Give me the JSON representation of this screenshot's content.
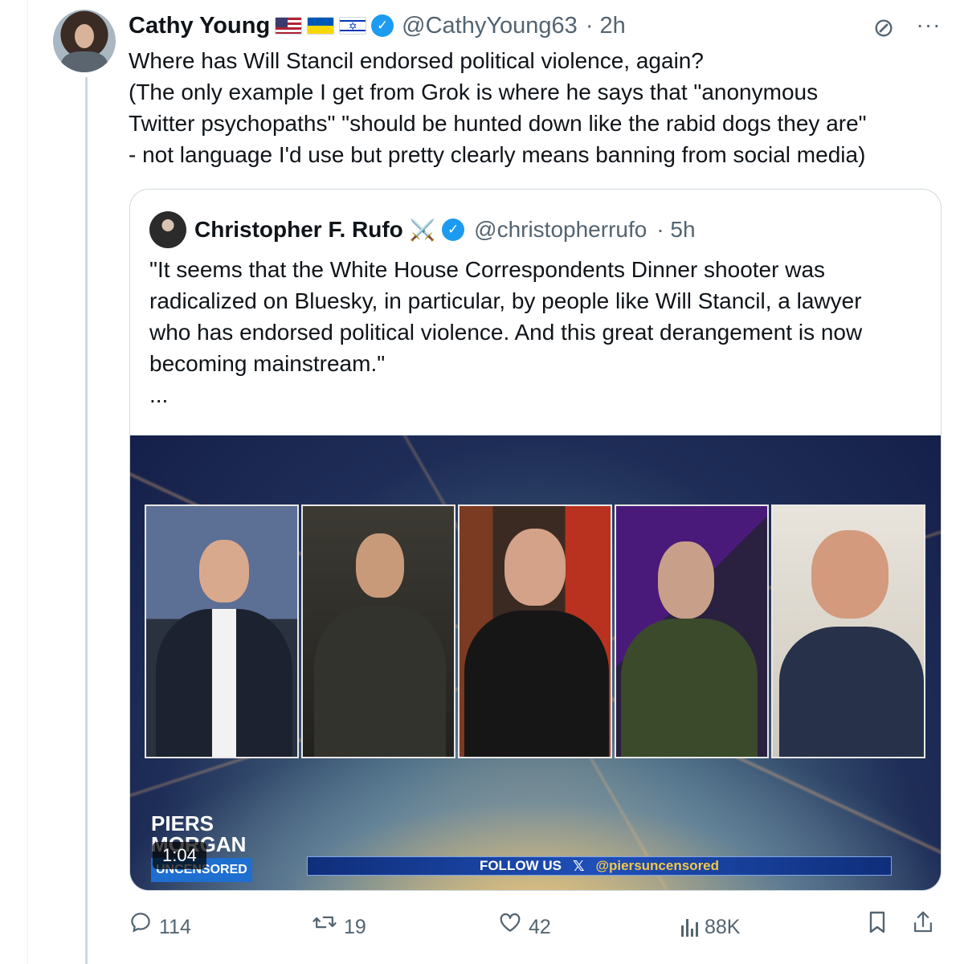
{
  "tweet": {
    "author_name": "Cathy Young",
    "handle": "@CathyYoung63",
    "time": "· 2h",
    "text_lines": [
      "Where has Will Stancil endorsed political violence, again?",
      "(The only example I get from Grok is where he says that \"anonymous",
      "Twitter psychopaths\" \"should be hunted down like the rabid dogs they are\"",
      "- not language I'd use but pretty clearly means banning from social media)"
    ],
    "flags": [
      "us-flag",
      "ukraine-flag",
      "israel-flag"
    ]
  },
  "quote": {
    "author_name": "Christopher F. Rufo",
    "emoji": "⚔️",
    "handle": "@christopherrufo",
    "time": "· 5h",
    "text_lines": [
      "\"It seems that the White House Correspondents Dinner shooter was",
      "radicalized on Bluesky, in particular, by people like Will Stancil, a lawyer",
      "who has endorsed political violence. And this great derangement is now",
      "becoming mainstream.\""
    ],
    "ellipsis": "...",
    "video": {
      "duration": "1:04",
      "logo_line1": "PIERS",
      "logo_line2": "MORGAN",
      "logo_line3": "UNCENSORED",
      "ticker_follow": "FOLLOW US",
      "ticker_x": "𝕏",
      "ticker_handle": "@piersuncensored"
    }
  },
  "actions": {
    "replies": "114",
    "reposts": "19",
    "likes": "42",
    "views": "88K"
  },
  "colors": {
    "verified": "#1d9bf0",
    "secondary_text": "#536471",
    "border": "#cfd9de"
  }
}
